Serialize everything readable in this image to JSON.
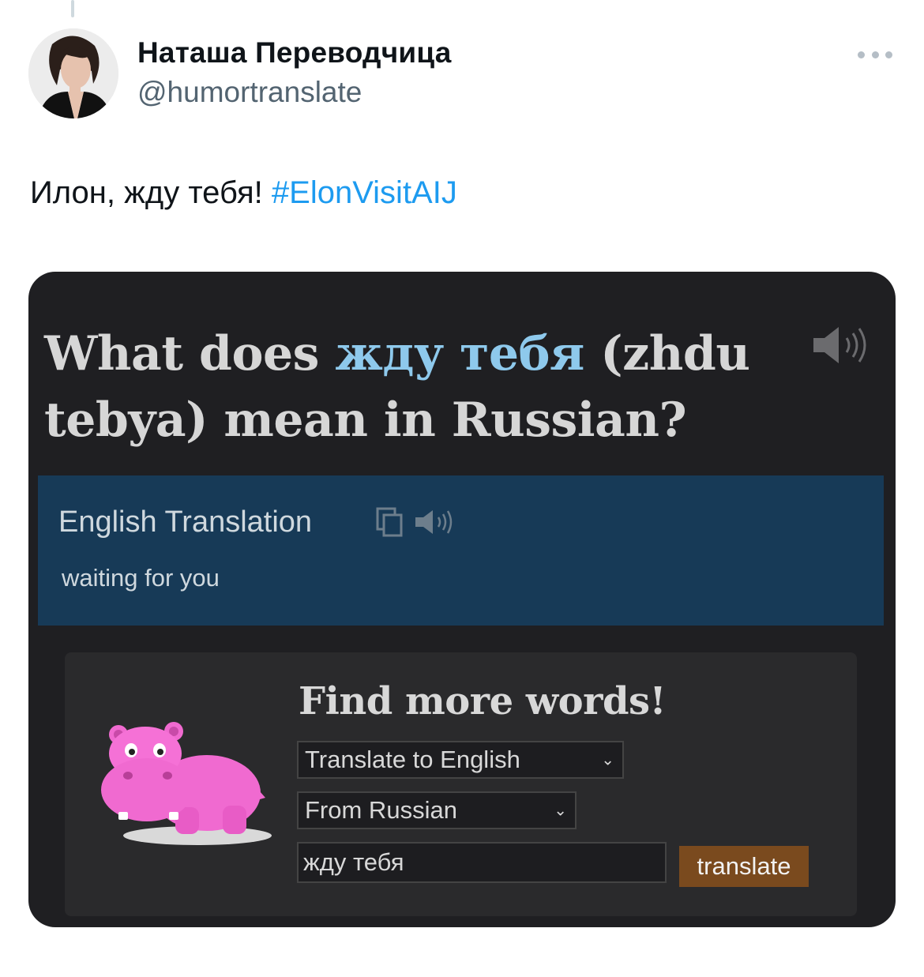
{
  "tweet": {
    "author": {
      "name": "Наташа Переводчица",
      "handle": "@humortranslate"
    },
    "text": "Илон, жду тебя! ",
    "hashtag": "#ElonVisitAIJ",
    "more_icon": "more-horizontal-icon"
  },
  "card": {
    "heading": {
      "prefix": "What does ",
      "highlight": "жду тебя",
      "suffix": " (zhdu tebya) mean in Russian?"
    },
    "translation": {
      "label": "English Translation",
      "text": "waiting for you",
      "icons": [
        "copy-icon",
        "speaker-icon"
      ]
    },
    "find_more": {
      "title": "Find more words!",
      "target_select": "Translate to English",
      "source_select": "From Russian",
      "input_value": "жду тебя",
      "button_label": "translate"
    }
  },
  "colors": {
    "hashtag": "#1d9bf0",
    "card_bg": "#1f1f22",
    "panel_bg": "#173a57",
    "highlight": "#8ec9ec",
    "button_bg": "#7a4a1e",
    "hippo": "#f06ad0"
  }
}
